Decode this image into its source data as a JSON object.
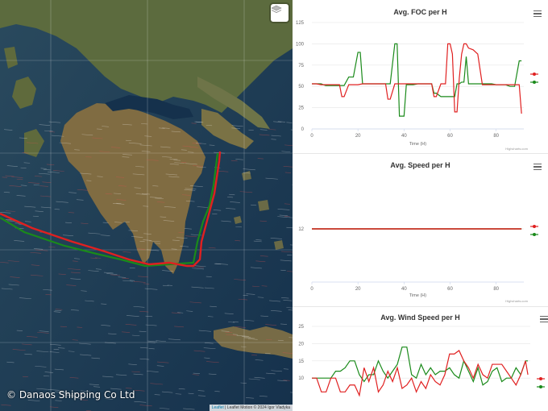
{
  "map": {
    "copyright": "© Danaos Shipping Co Ltd",
    "attribution_leaflet": "Leaflet",
    "attribution_rest": " | Leaflet Motion © 2024 Igor Vladyka",
    "layers_icon": "layers-icon",
    "route_colors": {
      "actual": "#e02020",
      "planned": "#1a8a1a"
    }
  },
  "charts": [
    {
      "title": "Avg. FOC per H",
      "xlabel": "Time (H)",
      "credits": "Highcharts.com",
      "chart_data": {
        "type": "line",
        "title": "Avg. FOC per H",
        "xlabel": "Time (H)",
        "ylabel": "",
        "xlim": [
          0,
          92
        ],
        "ylim": [
          0,
          125
        ],
        "xticks": [
          0,
          20,
          40,
          60,
          80
        ],
        "yticks": [
          0,
          25,
          50,
          75,
          100,
          125
        ],
        "series": [
          {
            "color": "#e02020",
            "x": [
              0,
              2,
              4,
              6,
              8,
              10,
              12,
              13,
              14,
              16,
              18,
              20,
              22,
              24,
              26,
              28,
              30,
              32,
              33,
              34,
              36,
              38,
              40,
              42,
              44,
              46,
              48,
              50,
              52,
              53,
              54,
              56,
              58,
              59,
              60,
              61,
              62,
              63,
              64,
              65,
              66,
              67,
              68,
              70,
              72,
              74,
              76,
              78,
              80,
              82,
              84,
              86,
              88,
              90,
              91
            ],
            "values": [
              53,
              53,
              52,
              52,
              52,
              52,
              52,
              38,
              38,
              52,
              52,
              52,
              53,
              53,
              53,
              53,
              53,
              53,
              35,
              35,
              53,
              53,
              53,
              53,
              53,
              53,
              53,
              53,
              53,
              38,
              38,
              53,
              53,
              100,
              100,
              88,
              20,
              20,
              60,
              88,
              100,
              100,
              95,
              93,
              88,
              52,
              52,
              52,
              52,
              52,
              52,
              52,
              52,
              52,
              18
            ]
          },
          {
            "color": "#1a8a1a",
            "x": [
              0,
              2,
              4,
              6,
              8,
              10,
              12,
              14,
              16,
              18,
              20,
              21,
              22,
              24,
              26,
              28,
              30,
              32,
              34,
              36,
              37,
              38,
              39,
              40,
              41,
              42,
              44,
              46,
              48,
              50,
              52,
              53,
              54,
              56,
              58,
              60,
              62,
              63,
              64,
              65,
              66,
              67,
              68,
              70,
              72,
              74,
              76,
              78,
              80,
              82,
              84,
              86,
              88,
              90,
              91
            ],
            "values": [
              53,
              53,
              53,
              51,
              51,
              51,
              51,
              51,
              61,
              61,
              90,
              90,
              53,
              53,
              53,
              53,
              53,
              53,
              53,
              100,
              100,
              15,
              15,
              15,
              52,
              52,
              52,
              53,
              53,
              53,
              53,
              42,
              42,
              38,
              38,
              38,
              38,
              53,
              53,
              55,
              55,
              85,
              53,
              53,
              53,
              53,
              53,
              53,
              52,
              52,
              52,
              50,
              50,
              80,
              80
            ]
          }
        ]
      }
    },
    {
      "title": "Avg. Speed per H",
      "xlabel": "Time (H)",
      "credits": "Highcharts.com",
      "chart_data": {
        "type": "line",
        "title": "Avg. Speed per H",
        "xlabel": "Time (H)",
        "ylabel": "",
        "xlim": [
          0,
          92
        ],
        "ylim": [
          0,
          24
        ],
        "xticks": [
          0,
          20,
          40,
          60,
          80
        ],
        "yticks": [
          12
        ],
        "series": [
          {
            "color": "#e02020",
            "x": [
              0,
              91
            ],
            "values": [
              12,
              12
            ]
          },
          {
            "color": "#1a8a1a",
            "x": [
              0,
              91
            ],
            "values": [
              12,
              12
            ]
          }
        ]
      }
    },
    {
      "title": "Avg. Wind Speed per H",
      "xlabel": "Time (H)",
      "credits": "Highcharts.com",
      "chart_data": {
        "type": "line",
        "title": "Avg. Wind Speed per H",
        "xlabel": "Time (H)",
        "ylabel": "",
        "xlim": [
          0,
          92
        ],
        "ylim": [
          0,
          25
        ],
        "xticks": [
          0,
          20,
          40,
          60,
          80
        ],
        "yticks": [
          10,
          15,
          20,
          25
        ],
        "series": [
          {
            "color": "#e02020",
            "x": [
              0,
              2,
              4,
              6,
              8,
              10,
              12,
              14,
              16,
              18,
              20,
              22,
              24,
              26,
              28,
              30,
              32,
              34,
              36,
              38,
              40,
              42,
              44,
              46,
              48,
              50,
              52,
              54,
              56,
              58,
              60,
              62,
              64,
              66,
              68,
              70,
              72,
              74,
              76,
              78,
              80,
              82,
              84,
              86,
              88,
              90,
              91
            ],
            "values": [
              10,
              10,
              6,
              6,
              10,
              10,
              6,
              6,
              8,
              8,
              5,
              13,
              9,
              13,
              6,
              8,
              12,
              9,
              13,
              7,
              8,
              10,
              6,
              9,
              7,
              11,
              9,
              8,
              11,
              17,
              17,
              18,
              15,
              13,
              10,
              14,
              11,
              10,
              14,
              14,
              14,
              12,
              10,
              8,
              11,
              15,
              11
            ]
          },
          {
            "color": "#1a8a1a",
            "x": [
              0,
              2,
              4,
              6,
              8,
              10,
              12,
              14,
              16,
              18,
              20,
              22,
              24,
              26,
              28,
              30,
              32,
              34,
              36,
              38,
              40,
              42,
              44,
              46,
              48,
              50,
              52,
              54,
              56,
              58,
              60,
              62,
              64,
              66,
              68,
              70,
              72,
              74,
              76,
              78,
              80,
              82,
              84,
              86,
              88,
              90,
              91
            ],
            "values": [
              10,
              10,
              10,
              10,
              10,
              12,
              12,
              13,
              15,
              15,
              11,
              9,
              11,
              11,
              15,
              12,
              10,
              12,
              14,
              19,
              19,
              11,
              10,
              14,
              11,
              13,
              11,
              12,
              12,
              13,
              11,
              10,
              15,
              12,
              9,
              13,
              8,
              9,
              12,
              13,
              9,
              10,
              10,
              13,
              11,
              15,
              15
            ]
          }
        ]
      }
    }
  ]
}
